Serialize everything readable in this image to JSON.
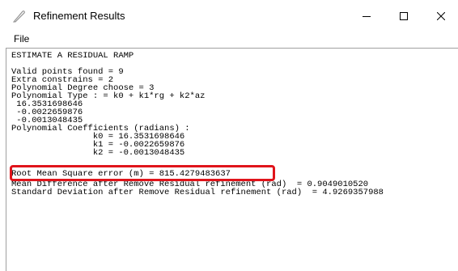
{
  "window": {
    "title": "Refinement Results",
    "icon": "feather-pen-icon",
    "controls": {
      "minimize": "minimize-icon",
      "maximize": "maximize-icon",
      "close": "close-icon"
    }
  },
  "menubar": {
    "items": [
      "File"
    ]
  },
  "output": {
    "lines": [
      "ESTIMATE A RESIDUAL RAMP",
      "",
      "Valid points found = 9",
      "Extra constrains = 2",
      "Polynomial Degree choose = 3",
      "Polynomial Type : = k0 + k1*rg + k2*az",
      " 16.3531698646",
      " -0.0022659876",
      " -0.0013048435",
      "Polynomial Coefficients (radians) :",
      "                k0 = 16.3531698646",
      "                k1 = -0.0022659876",
      "                k2 = -0.0013048435",
      "Root Mean Square error (m) = 815.4279483637",
      "Mean Difference after Remove Residual refinement (rad)  = 0.9049010520",
      "Standard Deviation after Remove Residual refinement (rad)  = 4.9269357988"
    ]
  },
  "highlight": {
    "color": "#e0141b",
    "target_line": "Root Mean Square error (m) = 815.4279483637"
  }
}
